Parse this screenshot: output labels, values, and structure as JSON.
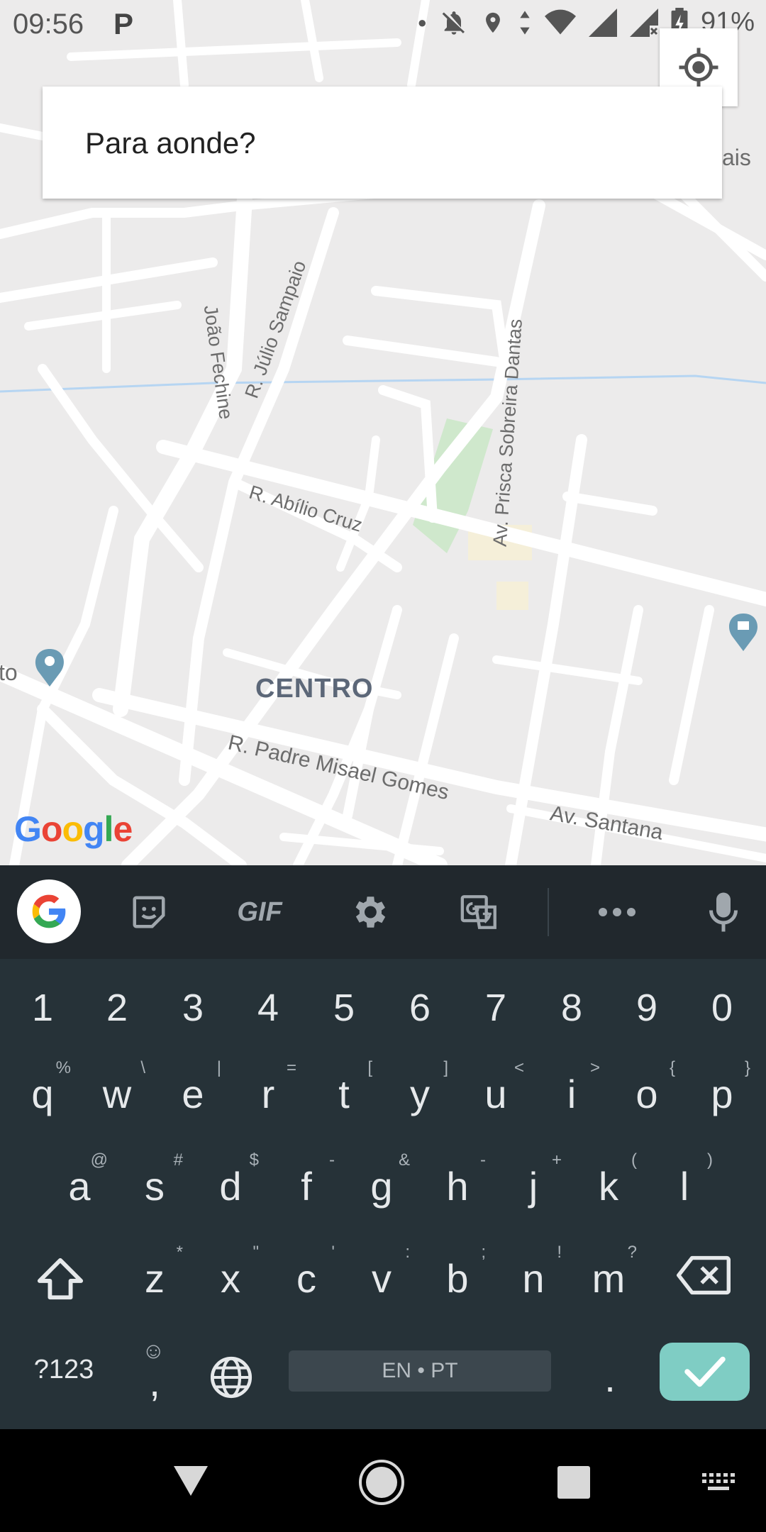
{
  "status_bar": {
    "time": "09:56",
    "app_letter": "P",
    "battery": "91%"
  },
  "search": {
    "placeholder": "Para aonde?"
  },
  "map": {
    "streets": [
      "João Fechine",
      "R. Júlio Sampaio",
      "Av. Prisca Sobreira Dantas",
      "R. Abílio Cruz",
      "R. Padre Misael Gomes",
      "Av. Santana"
    ],
    "edge_labels": {
      "left": "to",
      "right": "ais"
    },
    "district": "CENTRO",
    "logo": "Google"
  },
  "keyboard": {
    "toolbar": [
      "google-icon",
      "sticker-icon",
      "GIF",
      "settings-icon",
      "translate-icon",
      "more-icon",
      "mic-icon"
    ],
    "gif_label": "GIF",
    "numbers": [
      "1",
      "2",
      "3",
      "4",
      "5",
      "6",
      "7",
      "8",
      "9",
      "0"
    ],
    "row1": [
      {
        "k": "q",
        "a": "%"
      },
      {
        "k": "w",
        "a": "\\"
      },
      {
        "k": "e",
        "a": "|"
      },
      {
        "k": "r",
        "a": "="
      },
      {
        "k": "t",
        "a": "["
      },
      {
        "k": "y",
        "a": "]"
      },
      {
        "k": "u",
        "a": "<"
      },
      {
        "k": "i",
        "a": ">"
      },
      {
        "k": "o",
        "a": "{"
      },
      {
        "k": "p",
        "a": "}"
      }
    ],
    "row2": [
      {
        "k": "a",
        "a": "@"
      },
      {
        "k": "s",
        "a": "#"
      },
      {
        "k": "d",
        "a": "$"
      },
      {
        "k": "f",
        "a": "-"
      },
      {
        "k": "g",
        "a": "&"
      },
      {
        "k": "h",
        "a": "-"
      },
      {
        "k": "j",
        "a": "+"
      },
      {
        "k": "k",
        "a": "("
      },
      {
        "k": "l",
        "a": ")"
      }
    ],
    "row3": [
      {
        "k": "z",
        "a": "*"
      },
      {
        "k": "x",
        "a": "\""
      },
      {
        "k": "c",
        "a": "'"
      },
      {
        "k": "v",
        "a": ":"
      },
      {
        "k": "b",
        "a": ";"
      },
      {
        "k": "n",
        "a": "!"
      },
      {
        "k": "m",
        "a": "?"
      }
    ],
    "symbols_key": "?123",
    "emoji_comma": ",",
    "space_label": "EN • PT",
    "period": "."
  },
  "colors": {
    "map_bg": "#ecebeb",
    "park": "#cfe8cc",
    "keyboard_bg": "#263238",
    "toolbar_bg": "#21282d",
    "enter": "#7fcdc4"
  }
}
